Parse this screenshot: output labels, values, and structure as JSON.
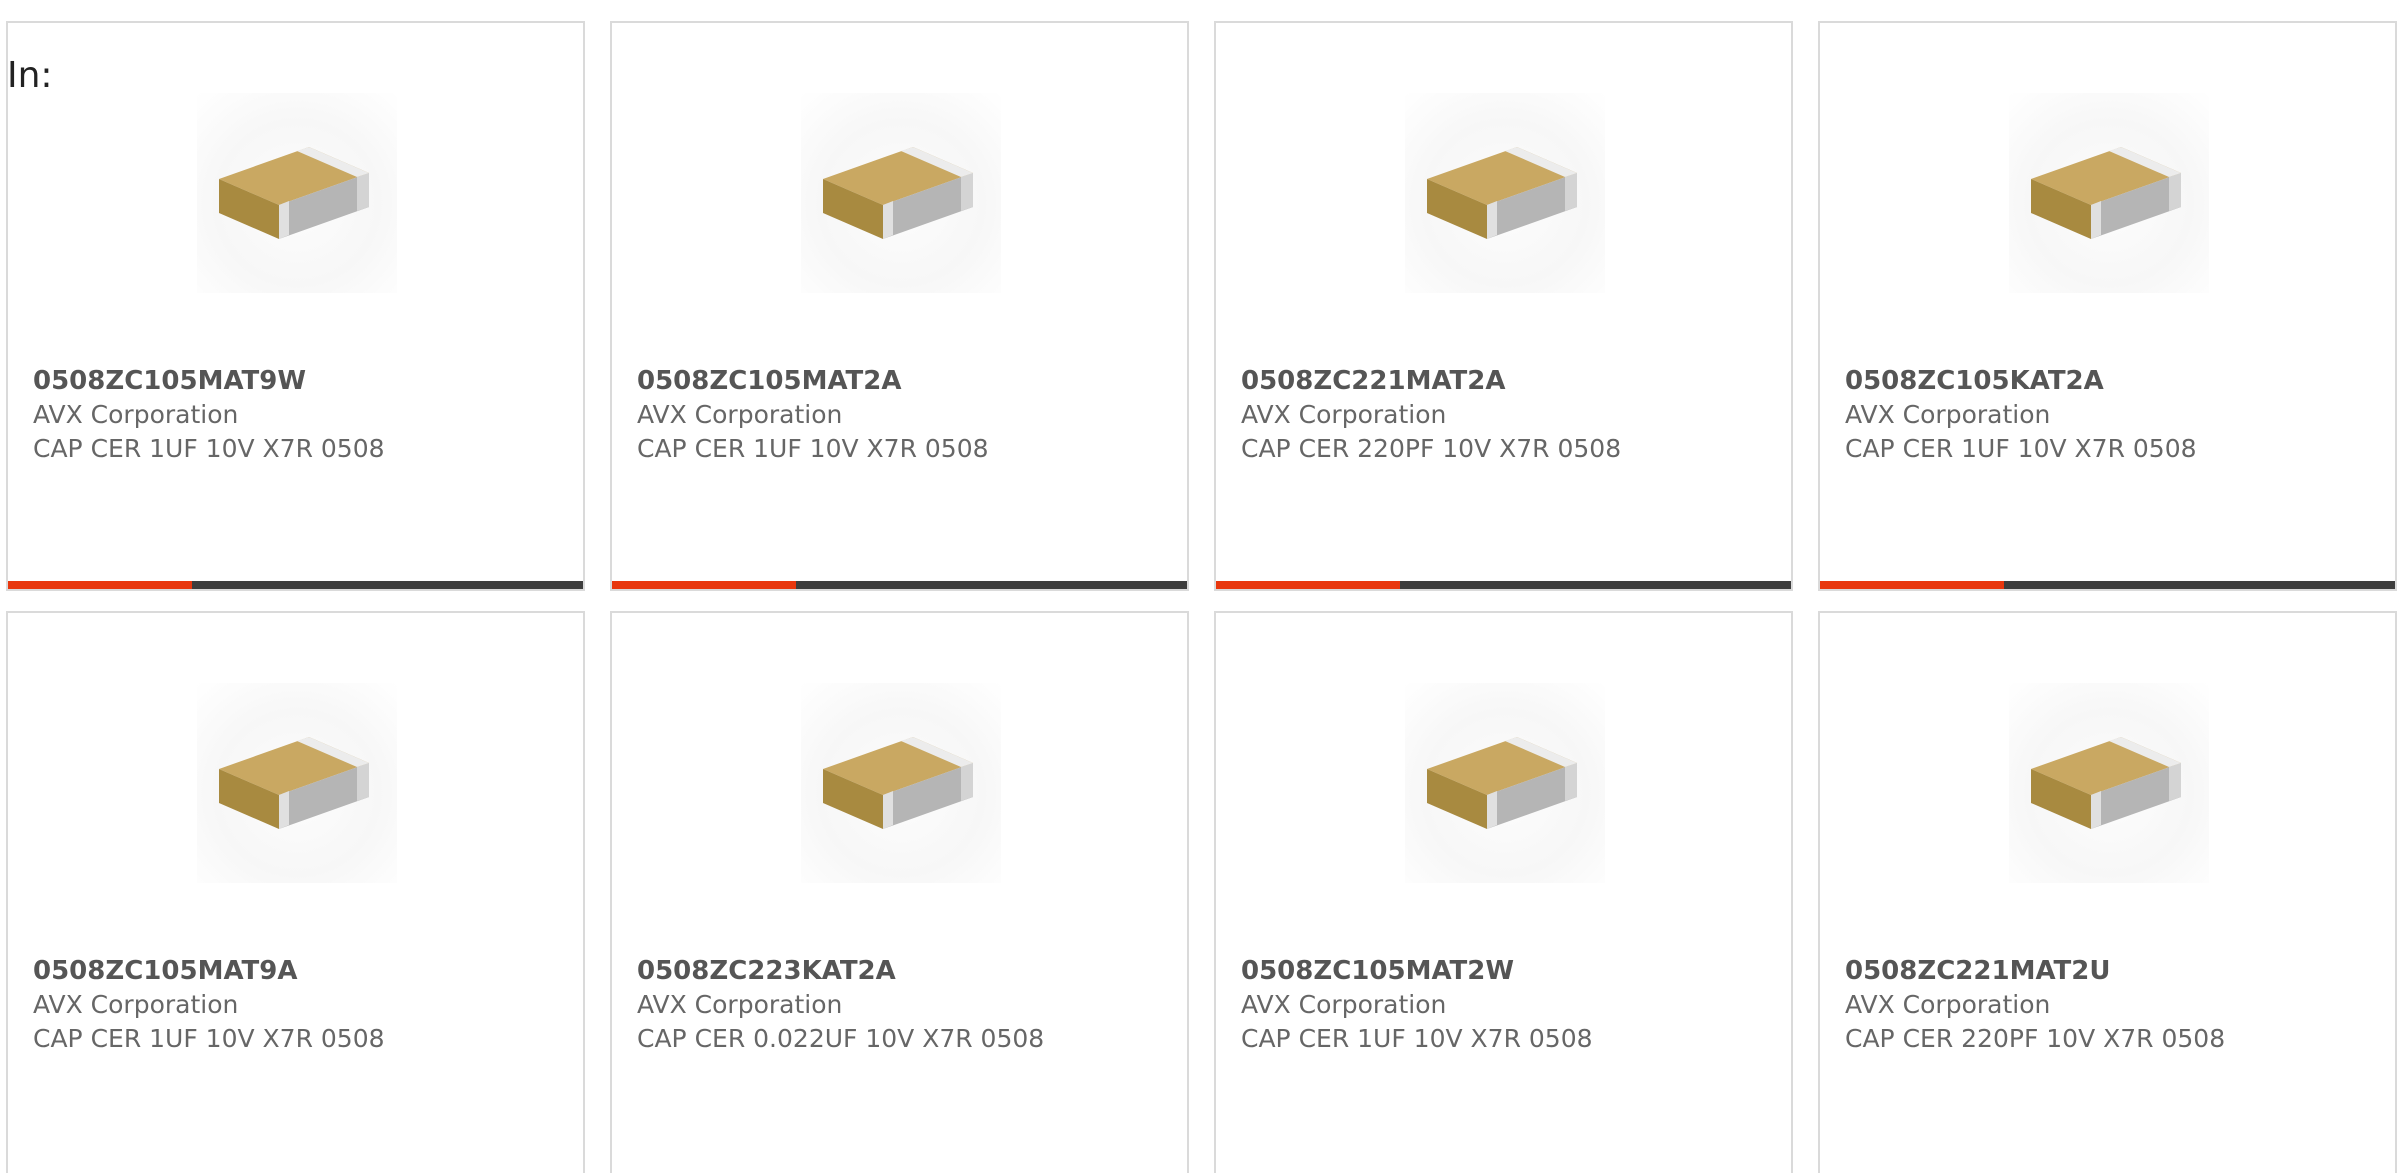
{
  "page": {
    "prefix_label": "In:",
    "accent_color": "#e8370e",
    "track_color": "#3d3d3d"
  },
  "products": [
    {
      "part_number": "0508ZC105MAT9W",
      "manufacturer": "AVX Corporation",
      "description": "CAP CER 1UF 10V X7R 0508",
      "image_icon": "ceramic-chip-capacitor-icon",
      "progress": 0.32
    },
    {
      "part_number": "0508ZC105MAT2A",
      "manufacturer": "AVX Corporation",
      "description": "CAP CER 1UF 10V X7R 0508",
      "image_icon": "ceramic-chip-capacitor-icon",
      "progress": 0.32
    },
    {
      "part_number": "0508ZC221MAT2A",
      "manufacturer": "AVX Corporation",
      "description": "CAP CER 220PF 10V X7R 0508",
      "image_icon": "ceramic-chip-capacitor-icon",
      "progress": 0.32
    },
    {
      "part_number": "0508ZC105KAT2A",
      "manufacturer": "AVX Corporation",
      "description": "CAP CER 1UF 10V X7R 0508",
      "image_icon": "ceramic-chip-capacitor-icon",
      "progress": 0.32
    },
    {
      "part_number": "0508ZC105MAT9A",
      "manufacturer": "AVX Corporation",
      "description": "CAP CER 1UF 10V X7R 0508",
      "image_icon": "ceramic-chip-capacitor-icon"
    },
    {
      "part_number": "0508ZC223KAT2A",
      "manufacturer": "AVX Corporation",
      "description": "CAP CER 0.022UF 10V X7R 0508",
      "image_icon": "ceramic-chip-capacitor-icon"
    },
    {
      "part_number": "0508ZC105MAT2W",
      "manufacturer": "AVX Corporation",
      "description": "CAP CER 1UF 10V X7R 0508",
      "image_icon": "ceramic-chip-capacitor-icon"
    },
    {
      "part_number": "0508ZC221MAT2U",
      "manufacturer": "AVX Corporation",
      "description": "CAP CER 220PF 10V X7R 0508",
      "image_icon": "ceramic-chip-capacitor-icon"
    }
  ]
}
